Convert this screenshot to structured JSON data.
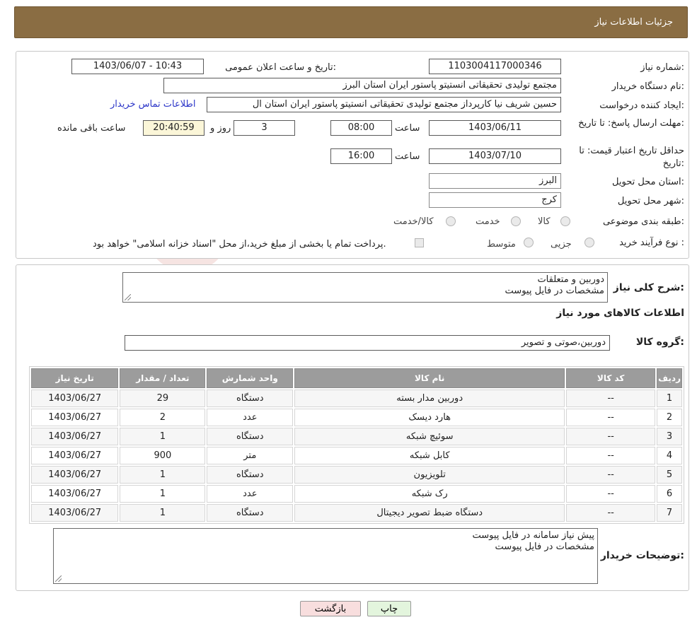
{
  "header": {
    "title": "جزئیات اطلاعات نیاز"
  },
  "form": {
    "need_number_label": "شماره نیاز:",
    "need_number": "1103004117000346",
    "announce_label": "تاریخ و ساعت اعلان عمومی:",
    "announce_value": "1403/06/07 - 10:43",
    "buyer_org_label": "نام دستگاه خریدار:",
    "buyer_org": "مجتمع تولیدی تحقیقاتی انستیتو پاستور ایران استان البرز",
    "creator_label": "ایجاد کننده درخواست:",
    "creator": "حسین شریف نیا کارپرداز مجتمع تولیدی تحقیقاتی انستیتو پاستور ایران استان ال",
    "contact_link": "اطلاعات تماس خریدار",
    "deadline_label": "مهلت ارسال پاسخ: تا تاریخ:",
    "deadline_date": "1403/06/11",
    "time_label": "ساعت",
    "deadline_time": "08:00",
    "days_value": "3",
    "days_label": "روز و",
    "remaining_time": "20:40:59",
    "remaining_label": "ساعت باقی مانده",
    "validity_label": "حداقل تاریخ اعتبار قیمت: تا تاریخ:",
    "validity_date": "1403/07/10",
    "validity_time": "16:00",
    "province_label": "استان محل تحویل:",
    "province": "البرز",
    "city_label": "شهر محل تحویل:",
    "city": "کرج",
    "category_label": "طبقه بندی موضوعی:",
    "category_options": [
      "کالا",
      "خدمت",
      "کالا/خدمت"
    ],
    "process_label": "نوع فرآیند خرید :",
    "process_options": [
      "جزیی",
      "متوسط"
    ],
    "process_note": "پرداخت تمام یا بخشی از مبلغ خرید،از محل \"اسناد خزانه اسلامی\" خواهد بود."
  },
  "description": {
    "label": "شرح کلی نیاز:",
    "line1": "دوربین و متعلقات",
    "line2": "مشخصات در فایل پیوست"
  },
  "goods": {
    "section_title": "اطلاعات کالاهای مورد نیاز",
    "group_label": "گروه کالا:",
    "group_value": "دوربین،صوتی و تصویر"
  },
  "table": {
    "headers": [
      "ردیف",
      "کد کالا",
      "نام کالا",
      "واحد شمارش",
      "تعداد / مقدار",
      "تاریخ نیاز"
    ],
    "rows": [
      [
        "1",
        "--",
        "دوربین مدار بسته",
        "دستگاه",
        "29",
        "1403/06/27"
      ],
      [
        "2",
        "--",
        "هارد دیسک",
        "عدد",
        "2",
        "1403/06/27"
      ],
      [
        "3",
        "--",
        "سوئیچ شبکه",
        "دستگاه",
        "1",
        "1403/06/27"
      ],
      [
        "4",
        "--",
        "کابل شبکه",
        "متر",
        "900",
        "1403/06/27"
      ],
      [
        "5",
        "--",
        "تلویزیون",
        "دستگاه",
        "1",
        "1403/06/27"
      ],
      [
        "6",
        "--",
        "رک شبکه",
        "عدد",
        "1",
        "1403/06/27"
      ],
      [
        "7",
        "--",
        "دستگاه ضبط تصویر دیجیتال",
        "دستگاه",
        "1",
        "1403/06/27"
      ]
    ]
  },
  "buyer_notes": {
    "label": "توضیحات خریدار:",
    "line1": "پیش نیاز سامانه در فایل پیوست",
    "line2": "مشخصات در فایل پیوست"
  },
  "buttons": {
    "print": "چاپ",
    "back": "بازگشت"
  },
  "watermark": {
    "text": "AriaTender.neT"
  },
  "colors": {
    "header_bg": "#8a6d43",
    "link": "#2b35c8",
    "table_header": "#9c9c9c",
    "back_button": "#f8dede",
    "print_button": "#e3f5dd"
  }
}
